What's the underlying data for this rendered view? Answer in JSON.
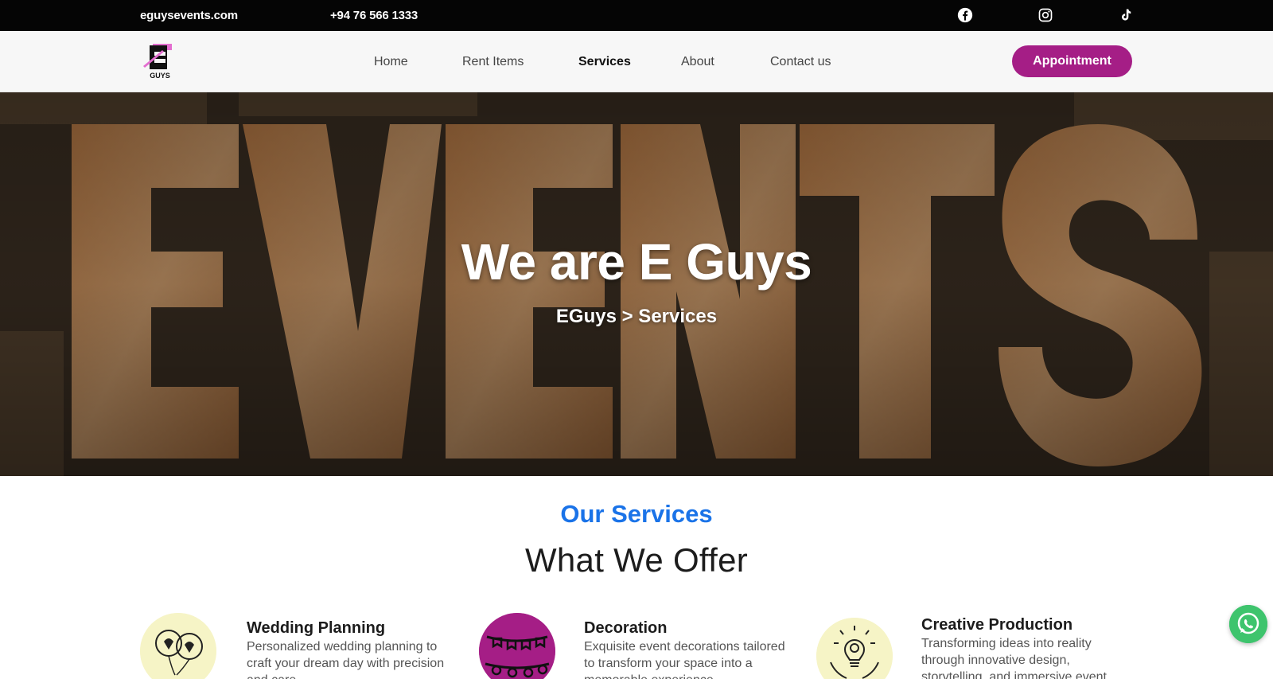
{
  "topbar": {
    "site": "eguysevents.com",
    "phone": "+94 76 566 1333",
    "social_icons": [
      "facebook-icon",
      "instagram-icon",
      "tiktok-icon"
    ]
  },
  "nav": {
    "logo_text": "GUYS",
    "items": [
      {
        "label": "Home"
      },
      {
        "label": "Rent Items"
      },
      {
        "label": "Services",
        "active": true
      },
      {
        "label": "About"
      },
      {
        "label": "Contact us"
      }
    ],
    "cta": "Appointment"
  },
  "hero": {
    "title": "We are E Guys",
    "breadcrumb": "EGuys > Services",
    "background_word": "EVENTS"
  },
  "services_section": {
    "eyebrow": "Our Services",
    "title": "What We Offer",
    "items": [
      {
        "title": "Wedding Planning",
        "description": "Personalized wedding planning to craft your dream day with precision and care.",
        "icon": "wedding-balloons-icon",
        "icon_bg": "#f6f4c6"
      },
      {
        "title": "Decoration",
        "description": "Exquisite event decorations tailored to transform your space into a memorable experience.",
        "icon": "bunting-decoration-icon",
        "icon_bg": "#a51e86"
      },
      {
        "title": "Creative Production",
        "description": "Transforming ideas into reality through innovative design, storytelling, and immersive event experiences.",
        "icon": "lightbulb-gear-icon",
        "icon_bg": "#f6f4c6"
      }
    ]
  },
  "colors": {
    "accent": "#a51e86",
    "eyebrow": "#1a73e8",
    "topbar": "#050505",
    "whatsapp": "#3ec46d"
  },
  "floating": {
    "icon": "whatsapp-icon"
  }
}
